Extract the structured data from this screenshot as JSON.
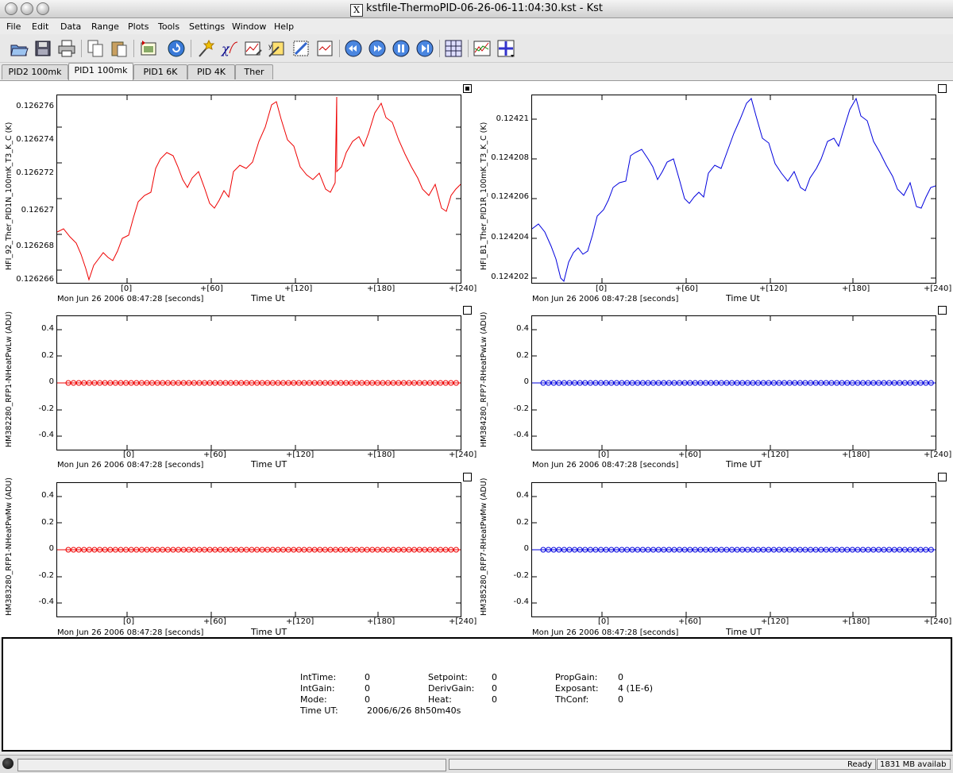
{
  "window": {
    "title": "kstfile-ThermoPID-06-26-06-11:04:30.kst - Kst"
  },
  "menu": [
    "File",
    "Edit",
    "Data",
    "Range",
    "Plots",
    "Tools",
    "Settings",
    "Window",
    "Help"
  ],
  "toolbar": {
    "icons": [
      "open-icon",
      "save-icon",
      "print-icon",
      "copy-icon",
      "paste-icon",
      "export-image-icon",
      "reload-icon",
      "data-wizard-icon",
      "plugin-icon",
      "edit-plot-icon",
      "vector-icon",
      "matrix-icon",
      "event-icon",
      "back-icon",
      "forward-icon",
      "pause-icon",
      "end-icon",
      "layout-grid-icon",
      "zoom-plot-icon",
      "zoom-xy-icon"
    ]
  },
  "tabs": [
    "PID2 100mk",
    "PID1 100mk",
    "PID1 6K",
    "PID 4K",
    "Ther"
  ],
  "active_tab": 1,
  "plots": [
    {
      "ylabel": "HFI_92_Ther_PID1N_100mK_T3_K_C (K)",
      "yticks": [
        "0.126276",
        "0.126274",
        "0.126272",
        "0.12627",
        "0.126268",
        "0.126266"
      ],
      "xticks": [
        "[0]",
        "+[60]",
        "+[120]",
        "+[180]",
        "+[240]"
      ],
      "xinfo": "Mon Jun 26 2006 08:47:28 [seconds]",
      "xlabel": "Time Ut",
      "color": "#ee0000"
    },
    {
      "ylabel": "HFI_B1_Ther_PID1R_100mK_T3_K_C (K)",
      "yticks": [
        "0.12421",
        "0.124208",
        "0.124206",
        "0.124204",
        "0.124202"
      ],
      "xticks": [
        "[0]",
        "+[60]",
        "+[120]",
        "+[180]",
        "+[240]"
      ],
      "xinfo": "Mon Jun 26 2006 08:47:28 [seconds]",
      "xlabel": "Time Ut",
      "color": "#0000dd"
    },
    {
      "ylabel": "HM382280_RFP1-NHeatPwLw (ADU)",
      "yticks": [
        "0.4",
        "0.2",
        "0",
        "-0.2",
        "-0.4"
      ],
      "xticks": [
        "[0]",
        "+[60]",
        "+[120]",
        "+[180]",
        "+[240]"
      ],
      "xinfo": "Mon Jun 26 2006 08:47:28 [seconds]",
      "xlabel": "Time UT",
      "color": "#ee0000"
    },
    {
      "ylabel": "HM384280_RFP7-RHeatPwLw (ADU)",
      "yticks": [
        "0.4",
        "0.2",
        "0",
        "-0.2",
        "-0.4"
      ],
      "xticks": [
        "[0]",
        "+[60]",
        "+[120]",
        "+[180]",
        "+[240]"
      ],
      "xinfo": "Mon Jun 26 2006 08:47:28 [seconds]",
      "xlabel": "Time UT",
      "color": "#0000dd"
    },
    {
      "ylabel": "HM383280_RFP1-NHeatPwMw (ADU)",
      "yticks": [
        "0.4",
        "0.2",
        "0",
        "-0.2",
        "-0.4"
      ],
      "xticks": [
        "[0]",
        "+[60]",
        "+[120]",
        "+[180]",
        "+[240]"
      ],
      "xinfo": "Mon Jun 26 2006 08:47:28 [seconds]",
      "xlabel": "Time UT",
      "color": "#ee0000"
    },
    {
      "ylabel": "HM385280_RFP7-RHeatPwMw (ADU)",
      "yticks": [
        "0.4",
        "0.2",
        "0",
        "-0.2",
        "-0.4"
      ],
      "xticks": [
        "[0]",
        "+[60]",
        "+[120]",
        "+[180]",
        "+[240]"
      ],
      "xinfo": "Mon Jun 26 2006 08:47:28 [seconds]",
      "xlabel": "Time UT",
      "color": "#0000dd"
    }
  ],
  "status": {
    "IntTime": [
      "IntTime:",
      "0"
    ],
    "IntGain": [
      "IntGain:",
      "0"
    ],
    "Mode": [
      "Mode:",
      "0"
    ],
    "TimeUT": [
      "Time UT:",
      "2006/6/26 8h50m40s"
    ],
    "Setpoint": [
      "Setpoint:",
      "0"
    ],
    "DerivGain": [
      "DerivGain:",
      "0"
    ],
    "Heat": [
      "Heat:",
      "0"
    ],
    "PropGain": [
      "PropGain:",
      "0"
    ],
    "Exposant": [
      "Exposant:",
      "4 (1E-6)"
    ],
    "ThConf": [
      "ThConf:",
      "0"
    ]
  },
  "statusbar": {
    "ready": "Ready",
    "memory": "1831 MB availab"
  }
}
